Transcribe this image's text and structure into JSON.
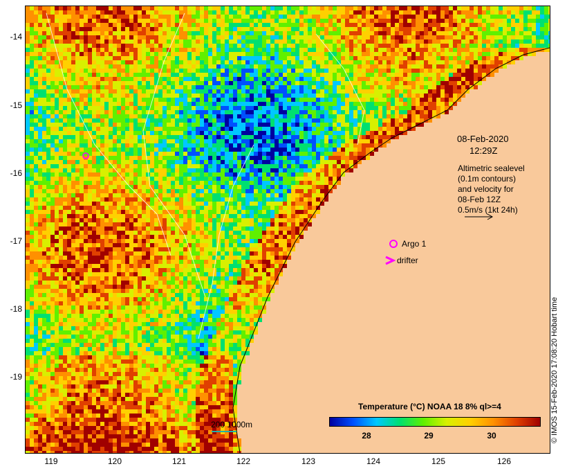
{
  "map": {
    "date_line": "08-Feb-2020",
    "time_line": "12:29Z",
    "description_lines": [
      "Altimetric sealevel",
      "(0.1m contours)",
      "and velocity for",
      "08-Feb 12Z",
      "0.5m/s (1kt 24h)"
    ],
    "legend": {
      "argo_label": "Argo 1",
      "drifter_label": "drifter",
      "argo_color": "#ff00ff",
      "drifter_color": "#ff00ff"
    },
    "scale_bar_label": "200  1000m",
    "credit": "© IMOS 15-Feb-2020 17:08:20 Hobart time",
    "colorbar": {
      "title": "Temperature (°C) NOAA 18 8% ql>=4",
      "ticks": [
        "28",
        "29",
        "30"
      ],
      "range": [
        27.5,
        30.8
      ],
      "colors": [
        "#0000a0",
        "#0050ff",
        "#00c8ff",
        "#00e070",
        "#60f000",
        "#d8f000",
        "#ffd000",
        "#ff9000",
        "#e04000",
        "#a00000"
      ]
    },
    "axes": {
      "latitude_ticks": [
        "-14",
        "-15",
        "-16",
        "-17",
        "-18",
        "-19"
      ],
      "longitude_ticks": [
        "119",
        "120",
        "121",
        "122",
        "123",
        "124",
        "125",
        "126"
      ],
      "lat_range": [
        -20.1,
        -13.5
      ],
      "lon_range": [
        118.65,
        126.7
      ]
    },
    "land_color": "#f9c99b"
  }
}
